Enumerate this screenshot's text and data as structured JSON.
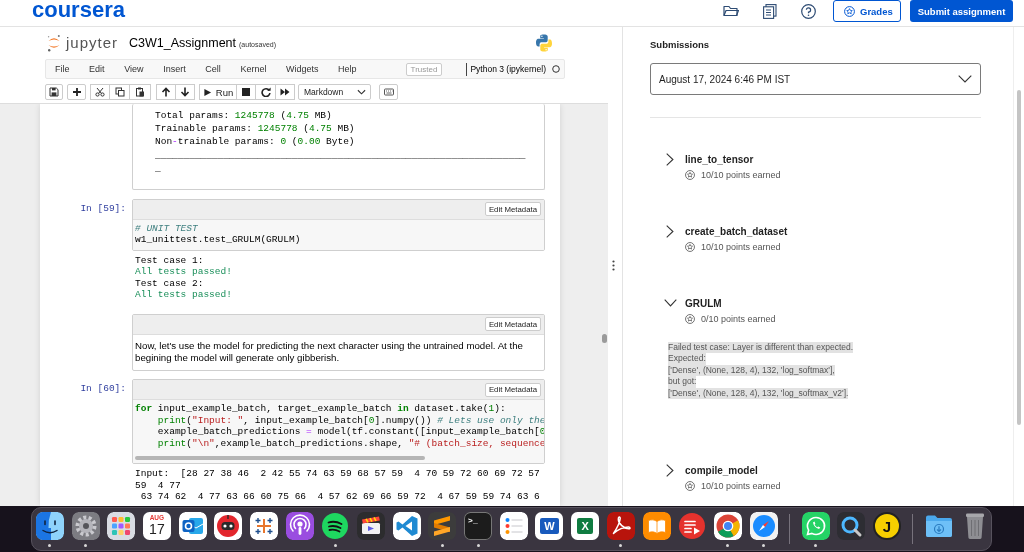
{
  "top_bar": {
    "logo": "coursera",
    "grades_button": "Grades",
    "submit_button": "Submit assignment"
  },
  "notebook": {
    "logo_text": "jupyter",
    "title": "C3W1_Assignment",
    "save_status": "(autosaved)",
    "menu": [
      "File",
      "Edit",
      "View",
      "Insert",
      "Cell",
      "Kernel",
      "Widgets",
      "Help"
    ],
    "trusted_badge": "Trusted",
    "kernel": "Python 3 (ipykernel)",
    "kernel_busy": false,
    "toolbar": {
      "run_button": "Run",
      "cell_type": "Markdown"
    },
    "cells": [
      {
        "kind": "output",
        "output": [
          [
            {
              "text": "Total params: ",
              "kind": "plain"
            },
            {
              "text": "1245778",
              "kind": "number"
            },
            {
              "text": " (",
              "kind": "plain"
            },
            {
              "text": "4.75",
              "kind": "number"
            },
            {
              "text": " MB)",
              "kind": "plain"
            }
          ],
          [
            {
              "text": "Trainable params: ",
              "kind": "plain"
            },
            {
              "text": "1245778",
              "kind": "number"
            },
            {
              "text": " (",
              "kind": "plain"
            },
            {
              "text": "4.75",
              "kind": "number"
            },
            {
              "text": " MB)",
              "kind": "plain"
            }
          ],
          [
            {
              "text": "Non",
              "kind": "plain"
            },
            {
              "text": "-",
              "kind": "operator"
            },
            {
              "text": "trainable params: ",
              "kind": "plain"
            },
            {
              "text": "0",
              "kind": "number"
            },
            {
              "text": " (",
              "kind": "plain"
            },
            {
              "text": "0.00",
              "kind": "number"
            },
            {
              "text": " Byte)",
              "kind": "plain"
            }
          ],
          "_________________________________________________________________",
          "_"
        ]
      },
      {
        "kind": "code",
        "prompt": "In [59]:",
        "metadata_button": "Edit Metadata",
        "scrollable": false,
        "code": [
          [
            {
              "text": "# UNIT TEST",
              "kind": "comment"
            }
          ],
          "w1_unittest.test_GRULM(GRULM)"
        ],
        "output": [
          "Test case 1:",
          [
            {
              "text": "All tests passed!",
              "kind": "success"
            }
          ],
          "Test case 2:",
          [
            {
              "text": "All tests passed!",
              "kind": "success"
            }
          ]
        ]
      },
      {
        "kind": "markdown",
        "metadata_button": "Edit Metadata",
        "text": "Now, let's use the model for predicting the next character using the untrained model. At the begining the model will generate only gibberish."
      },
      {
        "kind": "code",
        "prompt": "In [60]:",
        "metadata_button": "Edit Metadata",
        "scrollable": true,
        "code": [
          [
            {
              "text": "for",
              "kind": "keyword"
            },
            {
              "text": " input_example_batch, target_example_batch ",
              "kind": "plain"
            },
            {
              "text": "in",
              "kind": "keyword"
            },
            {
              "text": " dataset.take(",
              "kind": "plain"
            },
            {
              "text": "1",
              "kind": "number"
            },
            {
              "text": "):",
              "kind": "plain"
            }
          ],
          [
            {
              "text": "    print",
              "kind": "builtin"
            },
            {
              "text": "(",
              "kind": "plain"
            },
            {
              "text": "\"Input: \"",
              "kind": "string"
            },
            {
              "text": ", input_example_batch[",
              "kind": "plain"
            },
            {
              "text": "0",
              "kind": "number"
            },
            {
              "text": "].numpy()) ",
              "kind": "plain"
            },
            {
              "text": "# Lets use only the",
              "kind": "comment"
            }
          ],
          [
            {
              "text": "    example_batch_predictions ",
              "kind": "plain"
            },
            {
              "text": "=",
              "kind": "operator"
            },
            {
              "text": " model(tf.constant([input_example_batch[",
              "kind": "plain"
            },
            {
              "text": "0",
              "kind": "number"
            }
          ],
          [
            {
              "text": "    print",
              "kind": "builtin"
            },
            {
              "text": "(",
              "kind": "plain"
            },
            {
              "text": "\"\\n\"",
              "kind": "string"
            },
            {
              "text": ",example_batch_predictions.shape, ",
              "kind": "plain"
            },
            {
              "text": "\"# (batch_size, sequence",
              "kind": "string"
            }
          ]
        ],
        "output": [
          "Input:  [28 27 38 46  2 42 55 74 63 59 68 57 59  4 70 59 72 60 69 72 57",
          "59  4 77",
          " 63 74 62  4 77 63 66 60 75 66  4 57 62 69 66 59 72  4 67 59 59 74 63 6"
        ]
      }
    ]
  },
  "submissions": {
    "title": "Submissions",
    "selected_submission": "August 17, 2024 6:46 PM IST",
    "items": [
      {
        "name": "line_to_tensor",
        "points": "10/10 points earned",
        "expanded": false
      },
      {
        "name": "create_batch_dataset",
        "points": "10/10 points earned",
        "expanded": false
      },
      {
        "name": "GRULM",
        "points": "0/10 points earned",
        "expanded": true,
        "feedback": [
          "Failed test case: Layer is different than expected.",
          "Expected:",
          "['Dense', (None, 128, 4), 132, 'log_softmax'],",
          "but got:",
          "['Dense', (None, 128, 4), 132, 'log_softmax_v2']."
        ]
      },
      {
        "name": "compile_model",
        "points": "10/10 points earned",
        "expanded": false
      }
    ]
  },
  "dock": {
    "groups": [
      [
        {
          "kind": "face",
          "running": true
        },
        {
          "kind": "gear",
          "running": true
        },
        {
          "kind": "grid",
          "running": false
        },
        {
          "kind": "calendar",
          "month": "AUG",
          "day": "17",
          "running": false
        },
        {
          "kind": "envelope",
          "running": false
        },
        {
          "kind": "robot",
          "running": false
        },
        {
          "kind": "crosses",
          "running": false
        },
        {
          "kind": "podcast",
          "running": false
        },
        {
          "kind": "waves",
          "running": true
        },
        {
          "kind": "clapper",
          "running": false
        },
        {
          "kind": "code",
          "running": false
        },
        {
          "kind": "stripes",
          "running": true
        },
        {
          "kind": "terminal",
          "glyph": ">_",
          "running": true
        },
        {
          "kind": "checklist",
          "running": false
        },
        {
          "kind": "document",
          "glyph": "W",
          "running": false
        },
        {
          "kind": "spreadsheet",
          "glyph": "X",
          "running": false
        },
        {
          "kind": "swirl",
          "running": true
        },
        {
          "kind": "book",
          "running": false
        },
        {
          "kind": "playlist",
          "running": false
        },
        {
          "kind": "ring",
          "running": true
        },
        {
          "kind": "compass",
          "running": true
        }
      ],
      [
        {
          "kind": "chat",
          "running": true
        },
        {
          "kind": "magnifier",
          "running": false
        },
        {
          "kind": "letter",
          "glyph": "J",
          "running": false
        }
      ],
      [
        {
          "kind": "folder",
          "running": false
        },
        {
          "kind": "trash",
          "running": false
        }
      ]
    ]
  }
}
